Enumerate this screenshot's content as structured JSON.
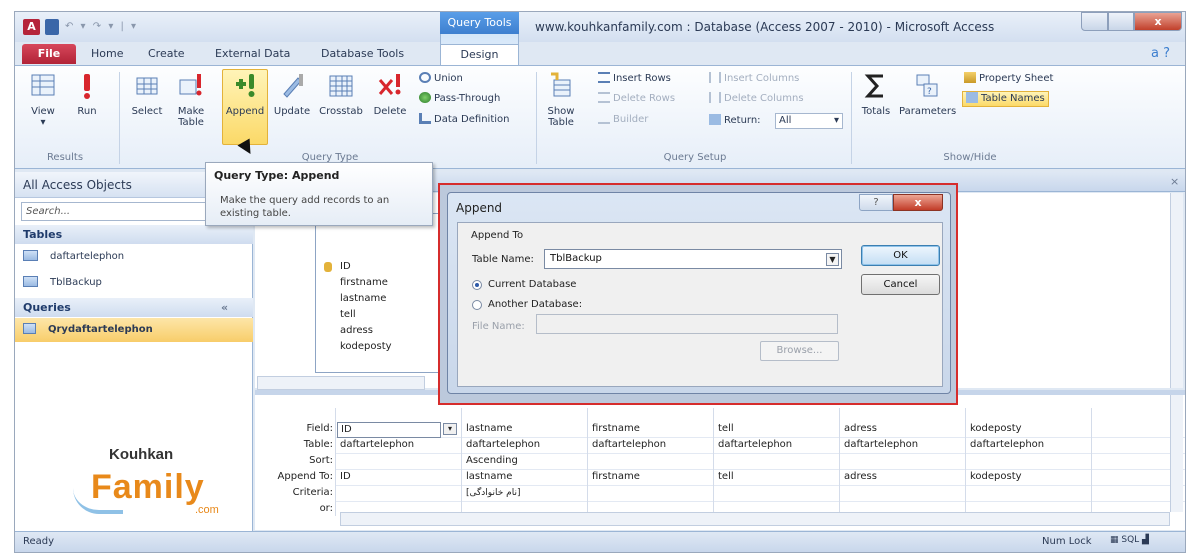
{
  "titlebar": {
    "app_icon": "A",
    "contextual_group": "Query Tools",
    "window_title": "www.kouhkanfamily.com : Database (Access 2007 - 2010)  -  Microsoft Access",
    "close_label": "x"
  },
  "tabs": {
    "file": "File",
    "home": "Home",
    "create": "Create",
    "external": "External Data",
    "dbtools": "Database Tools",
    "design": "Design",
    "help": "a ?"
  },
  "ribbon": {
    "results": {
      "view": "View",
      "run": "Run",
      "group": "Results"
    },
    "query_type": {
      "select": "Select",
      "make_table": "Make Table",
      "append": "Append",
      "update": "Update",
      "crosstab": "Crosstab",
      "delete": "Delete",
      "union": "Union",
      "pass_through": "Pass-Through",
      "data_definition": "Data Definition",
      "group": "Query Type"
    },
    "query_setup": {
      "show_table": "Show Table",
      "insert_rows": "Insert Rows",
      "delete_rows": "Delete Rows",
      "builder": "Builder",
      "insert_columns": "Insert Columns",
      "delete_columns": "Delete Columns",
      "return_label": "Return:",
      "return_value": "All",
      "group": "Query Setup"
    },
    "show_hide": {
      "totals": "Totals",
      "parameters": "Parameters",
      "property_sheet": "Property Sheet",
      "table_names": "Table Names",
      "group": "Show/Hide"
    }
  },
  "nav": {
    "title": "All Access Objects",
    "search_placeholder": "Search...",
    "tables_header": "Tables",
    "tables": [
      "daftartelephon",
      "TblBackup"
    ],
    "queries_header": "Queries",
    "queries": [
      "Qrydaftartelephon"
    ]
  },
  "tooltip": {
    "title": "Query Type: Append",
    "body": "Make the query add records to an existing table."
  },
  "table_box": {
    "fields": [
      "ID",
      "firstname",
      "lastname",
      "tell",
      "adress",
      "kodeposty"
    ]
  },
  "grid": {
    "row_labels": [
      "Field:",
      "Table:",
      "Sort:",
      "Append To:",
      "Criteria:",
      "or:"
    ],
    "columns": [
      {
        "field": "ID",
        "table": "daftartelephon",
        "sort": "",
        "append_to": "ID",
        "criteria": ""
      },
      {
        "field": "lastname",
        "table": "daftartelephon",
        "sort": "Ascending",
        "append_to": "lastname",
        "criteria": "[نام خانوادگی]"
      },
      {
        "field": "firstname",
        "table": "daftartelephon",
        "sort": "",
        "append_to": "firstname",
        "criteria": ""
      },
      {
        "field": "tell",
        "table": "daftartelephon",
        "sort": "",
        "append_to": "tell",
        "criteria": ""
      },
      {
        "field": "adress",
        "table": "daftartelephon",
        "sort": "",
        "append_to": "adress",
        "criteria": ""
      },
      {
        "field": "kodeposty",
        "table": "daftartelephon",
        "sort": "",
        "append_to": "kodeposty",
        "criteria": ""
      }
    ]
  },
  "dialog": {
    "title": "Append",
    "help": "?",
    "close": "x",
    "append_to": "Append To",
    "table_name_label": "Table Name:",
    "table_name_value": "TblBackup",
    "current_db": "Current Database",
    "another_db": "Another Database:",
    "file_name_label": "File Name:",
    "browse": "Browse...",
    "ok": "OK",
    "cancel": "Cancel"
  },
  "status": {
    "ready": "Ready",
    "num_lock": "Num Lock"
  },
  "logo": {
    "top": "Kouhkan",
    "main": "Family",
    "suffix": ".com"
  }
}
